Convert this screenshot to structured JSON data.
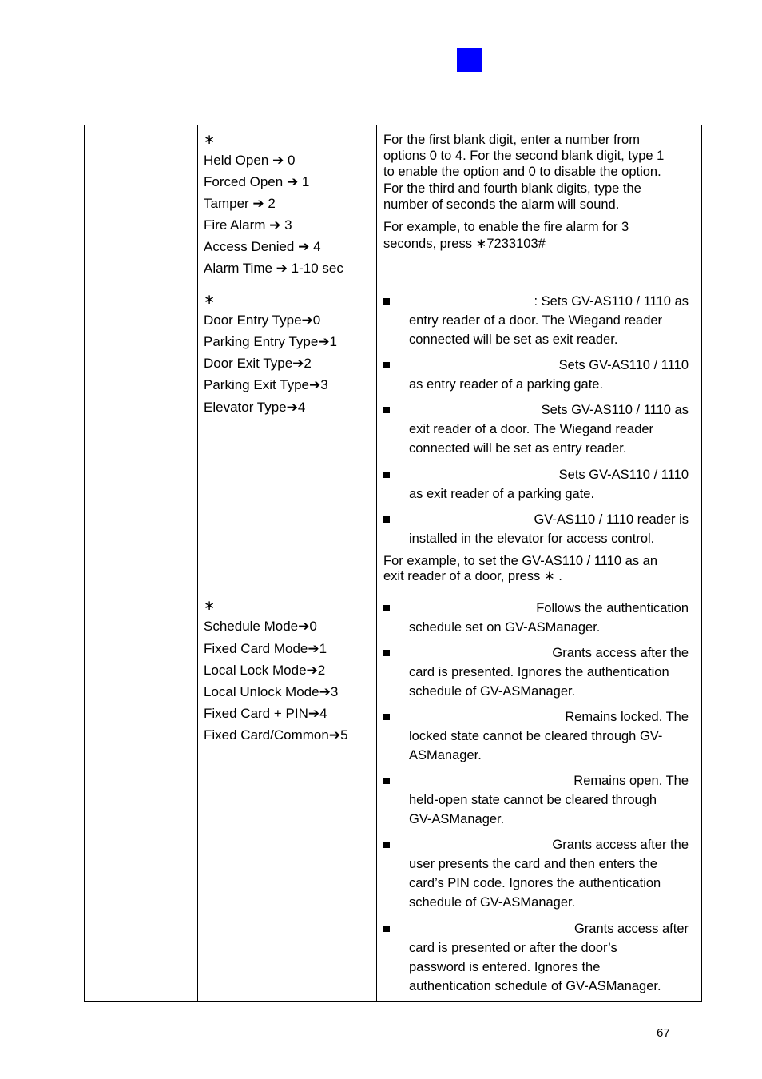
{
  "header": {
    "accent_color": "#0000ff"
  },
  "rows": [
    {
      "col2": [
        "∗",
        "Held Open ➔ 0",
        "Forced Open ➔ 1",
        "Tamper ➔ 2",
        "Fire Alarm ➔ 3",
        "Access Denied ➔ 4",
        "Alarm Time ➔ 1-10 sec"
      ],
      "col3": [
        "For the first blank digit, enter a number from",
        "options 0 to 4. For the second blank digit, type 1",
        "to enable the option and 0 to disable the option.",
        "For the third and fourth blank digits, type the",
        "number of seconds the alarm will sound.",
        "For example, to enable the fire alarm for 3",
        "seconds, press ∗7233103#"
      ]
    },
    {
      "col2": [
        "∗",
        "Door Entry Type➔0",
        "Parking Entry Type➔1",
        "Door Exit Type➔2",
        "Parking Exit Type➔3",
        "Elevator Type➔4"
      ],
      "bullets": [
        [
          ": Sets GV-AS110 / 1110 as",
          "entry reader of a door. The Wiegand reader",
          "connected will be set as exit reader."
        ],
        [
          "Sets GV-AS110 / 1110",
          "as entry reader of a parking gate."
        ],
        [
          "Sets GV-AS110 / 1110 as",
          "exit reader of a door. The Wiegand reader",
          "connected will be set as entry reader."
        ],
        [
          "Sets GV-AS110 / 1110",
          "as exit reader of a parking gate."
        ],
        [
          "GV-AS110 / 1110 reader is",
          "installed in the elevator for access control."
        ]
      ],
      "note": [
        "For example, to set the GV-AS110 / 1110 as an",
        "exit reader of a door, press ∗          ."
      ]
    },
    {
      "col2": [
        "∗",
        "Schedule Mode➔0",
        "Fixed Card Mode➔1",
        "Local Lock Mode➔2",
        "Local Unlock Mode➔3",
        "Fixed Card + PIN➔4",
        "Fixed Card/Common➔5"
      ],
      "bullets": [
        [
          "Follows the authentication",
          "schedule set on GV-ASManager."
        ],
        [
          "Grants access after the",
          "card is presented. Ignores the authentication",
          "schedule of GV-ASManager."
        ],
        [
          "Remains locked. The",
          "locked state cannot be cleared through GV-",
          "ASManager."
        ],
        [
          "Remains open. The",
          "held-open state cannot be cleared through",
          "GV-ASManager."
        ],
        [
          "Grants access after the",
          "user presents the card and then enters the",
          "card’s PIN code. Ignores the authentication",
          "schedule of GV-ASManager."
        ],
        [
          "Grants access after",
          "card is presented or after the door’s",
          "password is entered. Ignores the",
          "authentication schedule of GV-ASManager."
        ]
      ]
    }
  ],
  "footer": {
    "page_number": "67"
  }
}
